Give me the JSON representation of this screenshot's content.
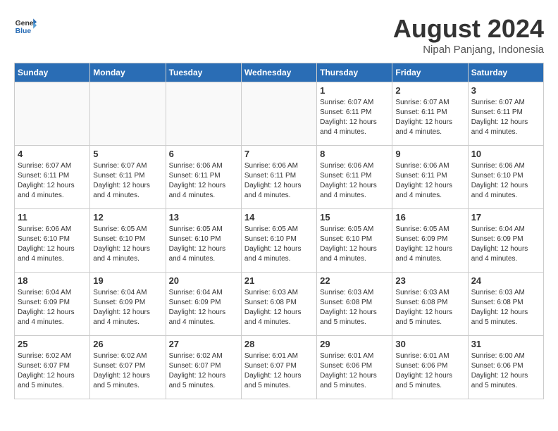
{
  "header": {
    "logo_line1": "General",
    "logo_line2": "Blue",
    "title": "August 2024",
    "subtitle": "Nipah Panjang, Indonesia"
  },
  "days_of_week": [
    "Sunday",
    "Monday",
    "Tuesday",
    "Wednesday",
    "Thursday",
    "Friday",
    "Saturday"
  ],
  "weeks": [
    [
      {
        "day": "",
        "info": ""
      },
      {
        "day": "",
        "info": ""
      },
      {
        "day": "",
        "info": ""
      },
      {
        "day": "",
        "info": ""
      },
      {
        "day": "1",
        "info": "Sunrise: 6:07 AM\nSunset: 6:11 PM\nDaylight: 12 hours and 4 minutes."
      },
      {
        "day": "2",
        "info": "Sunrise: 6:07 AM\nSunset: 6:11 PM\nDaylight: 12 hours and 4 minutes."
      },
      {
        "day": "3",
        "info": "Sunrise: 6:07 AM\nSunset: 6:11 PM\nDaylight: 12 hours and 4 minutes."
      }
    ],
    [
      {
        "day": "4",
        "info": "Sunrise: 6:07 AM\nSunset: 6:11 PM\nDaylight: 12 hours and 4 minutes."
      },
      {
        "day": "5",
        "info": "Sunrise: 6:07 AM\nSunset: 6:11 PM\nDaylight: 12 hours and 4 minutes."
      },
      {
        "day": "6",
        "info": "Sunrise: 6:06 AM\nSunset: 6:11 PM\nDaylight: 12 hours and 4 minutes."
      },
      {
        "day": "7",
        "info": "Sunrise: 6:06 AM\nSunset: 6:11 PM\nDaylight: 12 hours and 4 minutes."
      },
      {
        "day": "8",
        "info": "Sunrise: 6:06 AM\nSunset: 6:11 PM\nDaylight: 12 hours and 4 minutes."
      },
      {
        "day": "9",
        "info": "Sunrise: 6:06 AM\nSunset: 6:11 PM\nDaylight: 12 hours and 4 minutes."
      },
      {
        "day": "10",
        "info": "Sunrise: 6:06 AM\nSunset: 6:10 PM\nDaylight: 12 hours and 4 minutes."
      }
    ],
    [
      {
        "day": "11",
        "info": "Sunrise: 6:06 AM\nSunset: 6:10 PM\nDaylight: 12 hours and 4 minutes."
      },
      {
        "day": "12",
        "info": "Sunrise: 6:05 AM\nSunset: 6:10 PM\nDaylight: 12 hours and 4 minutes."
      },
      {
        "day": "13",
        "info": "Sunrise: 6:05 AM\nSunset: 6:10 PM\nDaylight: 12 hours and 4 minutes."
      },
      {
        "day": "14",
        "info": "Sunrise: 6:05 AM\nSunset: 6:10 PM\nDaylight: 12 hours and 4 minutes."
      },
      {
        "day": "15",
        "info": "Sunrise: 6:05 AM\nSunset: 6:10 PM\nDaylight: 12 hours and 4 minutes."
      },
      {
        "day": "16",
        "info": "Sunrise: 6:05 AM\nSunset: 6:09 PM\nDaylight: 12 hours and 4 minutes."
      },
      {
        "day": "17",
        "info": "Sunrise: 6:04 AM\nSunset: 6:09 PM\nDaylight: 12 hours and 4 minutes."
      }
    ],
    [
      {
        "day": "18",
        "info": "Sunrise: 6:04 AM\nSunset: 6:09 PM\nDaylight: 12 hours and 4 minutes."
      },
      {
        "day": "19",
        "info": "Sunrise: 6:04 AM\nSunset: 6:09 PM\nDaylight: 12 hours and 4 minutes."
      },
      {
        "day": "20",
        "info": "Sunrise: 6:04 AM\nSunset: 6:09 PM\nDaylight: 12 hours and 4 minutes."
      },
      {
        "day": "21",
        "info": "Sunrise: 6:03 AM\nSunset: 6:08 PM\nDaylight: 12 hours and 4 minutes."
      },
      {
        "day": "22",
        "info": "Sunrise: 6:03 AM\nSunset: 6:08 PM\nDaylight: 12 hours and 5 minutes."
      },
      {
        "day": "23",
        "info": "Sunrise: 6:03 AM\nSunset: 6:08 PM\nDaylight: 12 hours and 5 minutes."
      },
      {
        "day": "24",
        "info": "Sunrise: 6:03 AM\nSunset: 6:08 PM\nDaylight: 12 hours and 5 minutes."
      }
    ],
    [
      {
        "day": "25",
        "info": "Sunrise: 6:02 AM\nSunset: 6:07 PM\nDaylight: 12 hours and 5 minutes."
      },
      {
        "day": "26",
        "info": "Sunrise: 6:02 AM\nSunset: 6:07 PM\nDaylight: 12 hours and 5 minutes."
      },
      {
        "day": "27",
        "info": "Sunrise: 6:02 AM\nSunset: 6:07 PM\nDaylight: 12 hours and 5 minutes."
      },
      {
        "day": "28",
        "info": "Sunrise: 6:01 AM\nSunset: 6:07 PM\nDaylight: 12 hours and 5 minutes."
      },
      {
        "day": "29",
        "info": "Sunrise: 6:01 AM\nSunset: 6:06 PM\nDaylight: 12 hours and 5 minutes."
      },
      {
        "day": "30",
        "info": "Sunrise: 6:01 AM\nSunset: 6:06 PM\nDaylight: 12 hours and 5 minutes."
      },
      {
        "day": "31",
        "info": "Sunrise: 6:00 AM\nSunset: 6:06 PM\nDaylight: 12 hours and 5 minutes."
      }
    ]
  ]
}
